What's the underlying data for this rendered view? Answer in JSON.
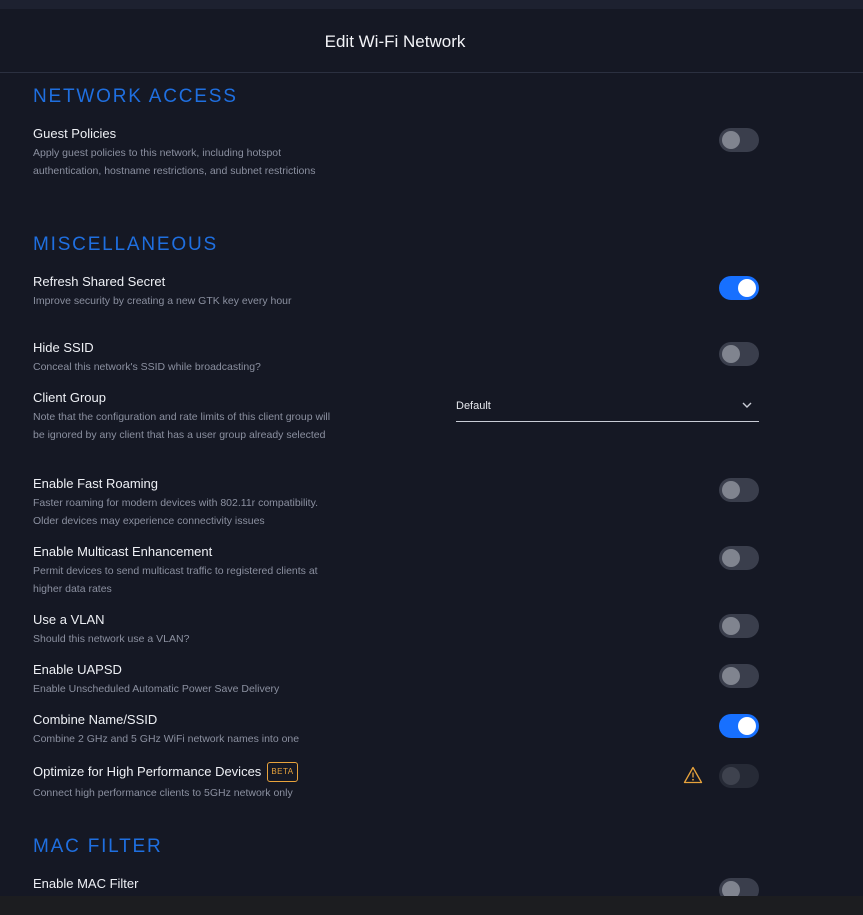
{
  "header": {
    "title": "Edit Wi-Fi Network"
  },
  "sections": {
    "network_access": "NETWORK ACCESS",
    "miscellaneous": "MISCELLANEOUS",
    "mac_filter": "MAC FILTER"
  },
  "settings": {
    "guest_policies": {
      "label": "Guest Policies",
      "desc": "Apply guest policies to this network, including hotspot authentication, hostname restrictions, and subnet restrictions",
      "enabled": false
    },
    "refresh_shared_secret": {
      "label": "Refresh Shared Secret",
      "desc": "Improve security by creating a new GTK key every hour",
      "enabled": true
    },
    "hide_ssid": {
      "label": "Hide SSID",
      "desc": "Conceal this network's SSID while broadcasting?",
      "enabled": false
    },
    "client_group": {
      "label": "Client Group",
      "desc": "Note that the configuration and rate limits of this client group will be ignored by any client that has a user group already selected",
      "value": "Default"
    },
    "fast_roaming": {
      "label": "Enable Fast Roaming",
      "desc": "Faster roaming for modern devices with 802.11r compatibility. Older devices may experience connectivity issues",
      "enabled": false
    },
    "multicast_enhancement": {
      "label": "Enable Multicast Enhancement",
      "desc": "Permit devices to send multicast traffic to registered clients at higher data rates",
      "enabled": false
    },
    "use_vlan": {
      "label": "Use a VLAN",
      "desc": "Should this network use a VLAN?",
      "enabled": false
    },
    "uapsd": {
      "label": "Enable UAPSD",
      "desc": "Enable Unscheduled Automatic Power Save Delivery",
      "enabled": false
    },
    "combine_name_ssid": {
      "label": "Combine Name/SSID",
      "desc": "Combine 2 GHz and 5 GHz WiFi network names into one",
      "enabled": true
    },
    "high_performance": {
      "label": "Optimize for High Performance Devices",
      "badge": "BETA",
      "desc": "Connect high performance clients to 5GHz network only",
      "enabled": false,
      "warning_icon": "warning-triangle-icon"
    },
    "mac_filter": {
      "label": "Enable MAC Filter",
      "enabled": false
    }
  },
  "colors": {
    "accent": "#1770ff",
    "section": "#1f6fe0",
    "warning": "#e8a33c",
    "background": "#151824"
  }
}
